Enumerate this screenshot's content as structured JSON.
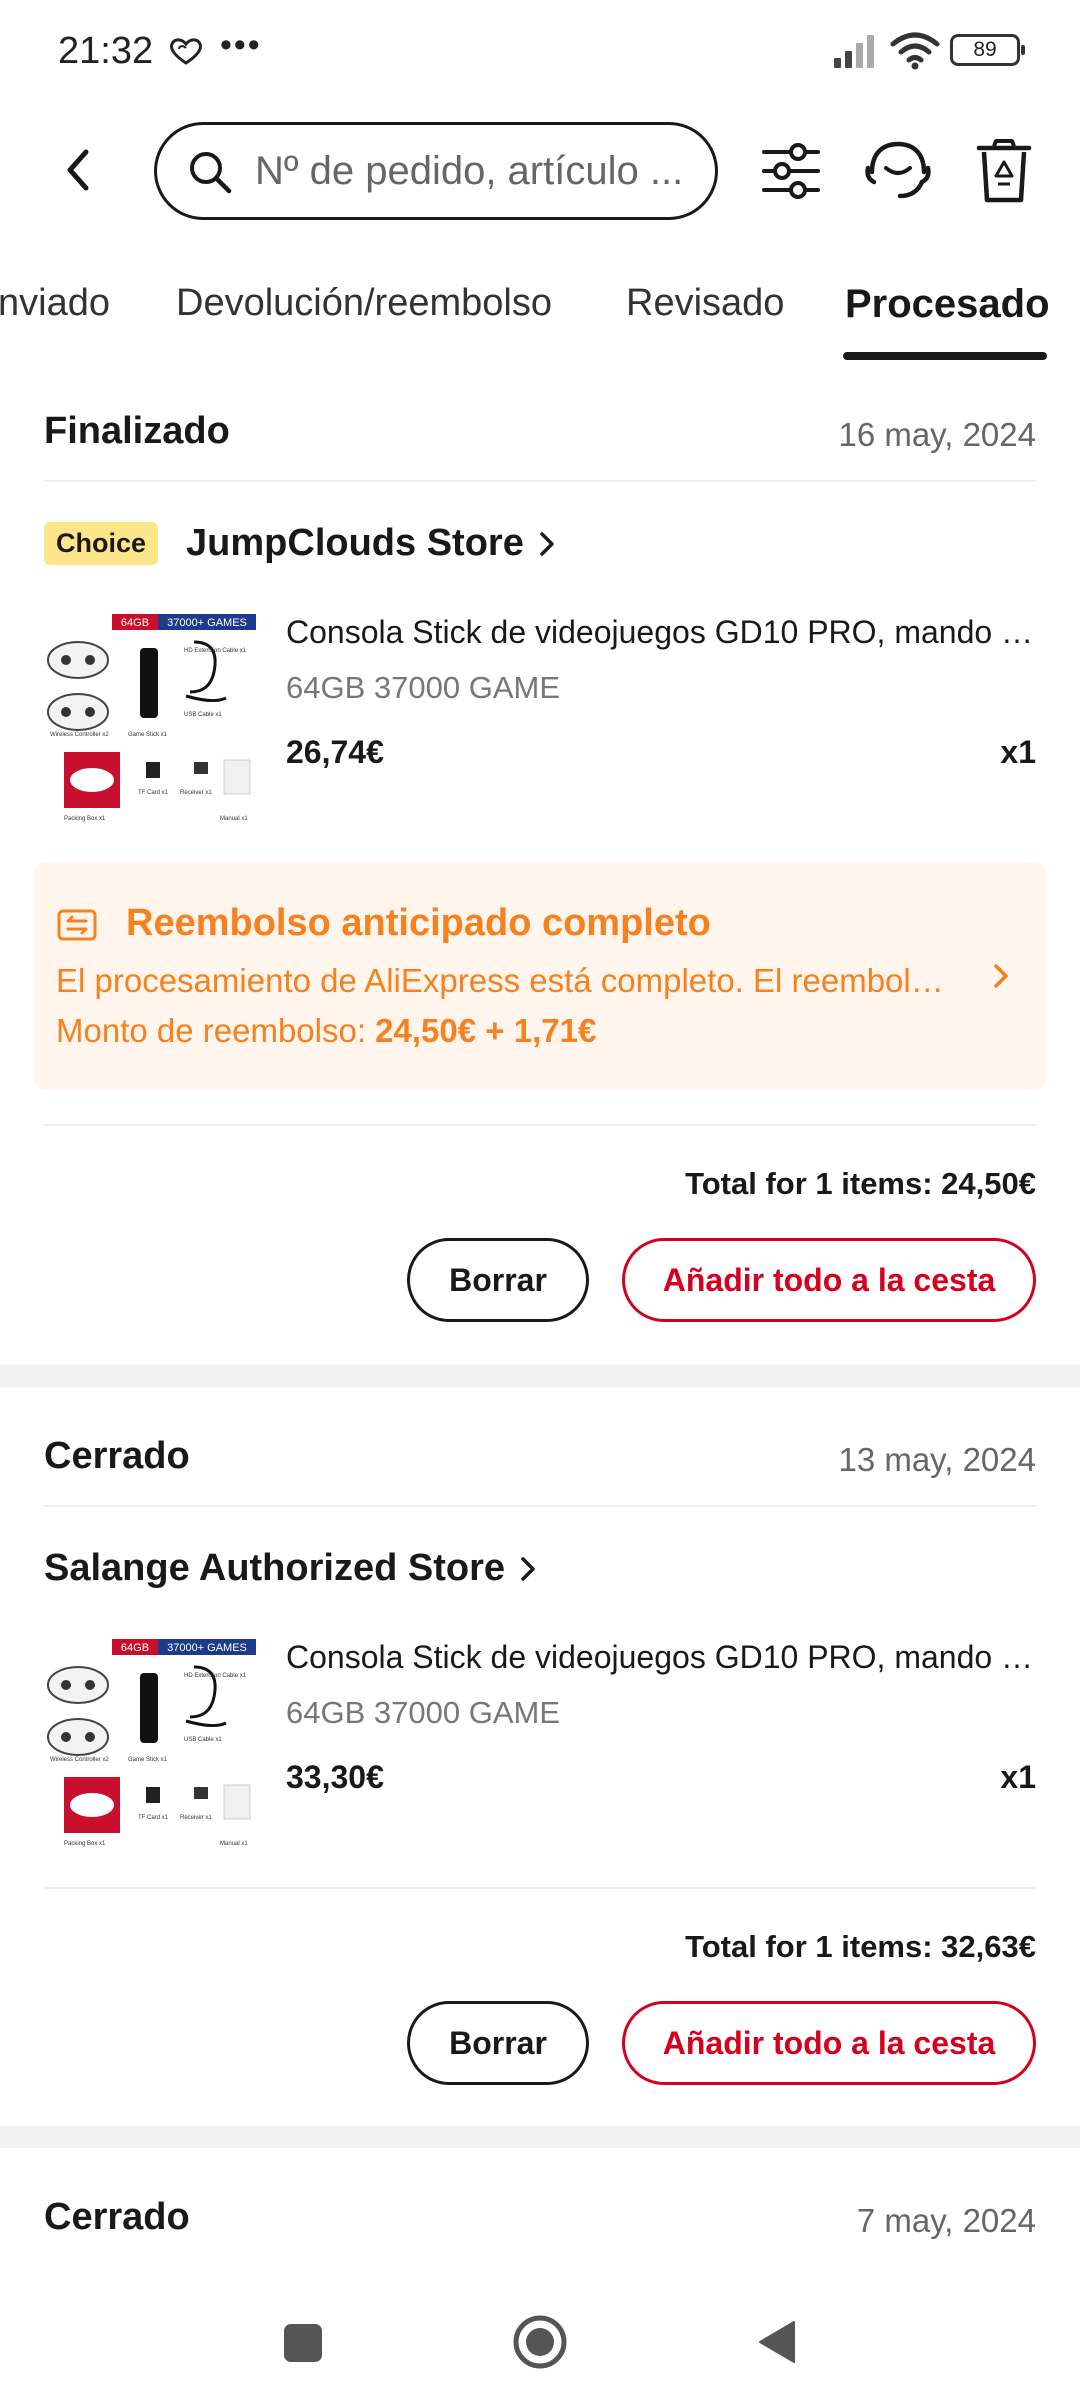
{
  "status_bar": {
    "time": "21:32",
    "dots": "•••",
    "battery": "89",
    "icons": [
      "heart-outline-icon",
      "signal-icon",
      "wifi-icon",
      "battery-icon"
    ]
  },
  "header": {
    "search_placeholder": "Nº de pedido, artículo ...",
    "icons": [
      "back-arrow-icon",
      "search-icon",
      "filter-sliders-icon",
      "support-headset-icon",
      "trash-icon"
    ]
  },
  "tabs": [
    {
      "label": "nviado"
    },
    {
      "label": "Devolución/reembolso"
    },
    {
      "label": "Revisado"
    },
    {
      "label": "Procesado",
      "active": true
    }
  ],
  "orders": [
    {
      "status": "Finalizado",
      "date": "16 may, 2024",
      "badge": "Choice",
      "store": "JumpClouds Store",
      "product": {
        "title": "Consola Stick de videojuegos GD10 PRO, mando inalámbrico",
        "variant": "64GB 37000 GAME",
        "price": "26,74€",
        "qty": "x1"
      },
      "refund": {
        "title": "Reembolso anticipado completo",
        "description": "El procesamiento de AliExpress está completo. El reembolso se ha emitido",
        "amount_label": "Monto de reembolso: ",
        "amount_value": "24,50€ + 1,71€"
      },
      "total": "Total for 1 items: 24,50€",
      "delete_label": "Borrar",
      "cart_label": "Añadir todo a la cesta"
    },
    {
      "status": "Cerrado",
      "date": "13 may, 2024",
      "store": "Salange Authorized Store",
      "product": {
        "title": "Consola Stick de videojuegos GD10 PRO, mando inalámbrico",
        "variant": "64GB 37000 GAME",
        "price": "33,30€",
        "qty": "x1"
      },
      "total": "Total for 1 items: 32,63€",
      "delete_label": "Borrar",
      "cart_label": "Añadir todo a la cesta"
    },
    {
      "status": "Cerrado",
      "date": "7 may, 2024"
    }
  ],
  "thumbnail": {
    "tag_storage": "64GB",
    "tag_games": "37000+ GAMES",
    "labels": [
      "Wireless Controller x2",
      "Game Stick x1",
      "HD Extension Cable x1",
      "USB Cable x1",
      "TF Card x1",
      "Receiver x1",
      "Packing Box x1",
      "Manual x1"
    ]
  },
  "colors": {
    "accent_red": "#d4001e",
    "refund_orange": "#f5811f",
    "refund_bg": "#fff5ec",
    "choice_badge": "#fde68a"
  }
}
